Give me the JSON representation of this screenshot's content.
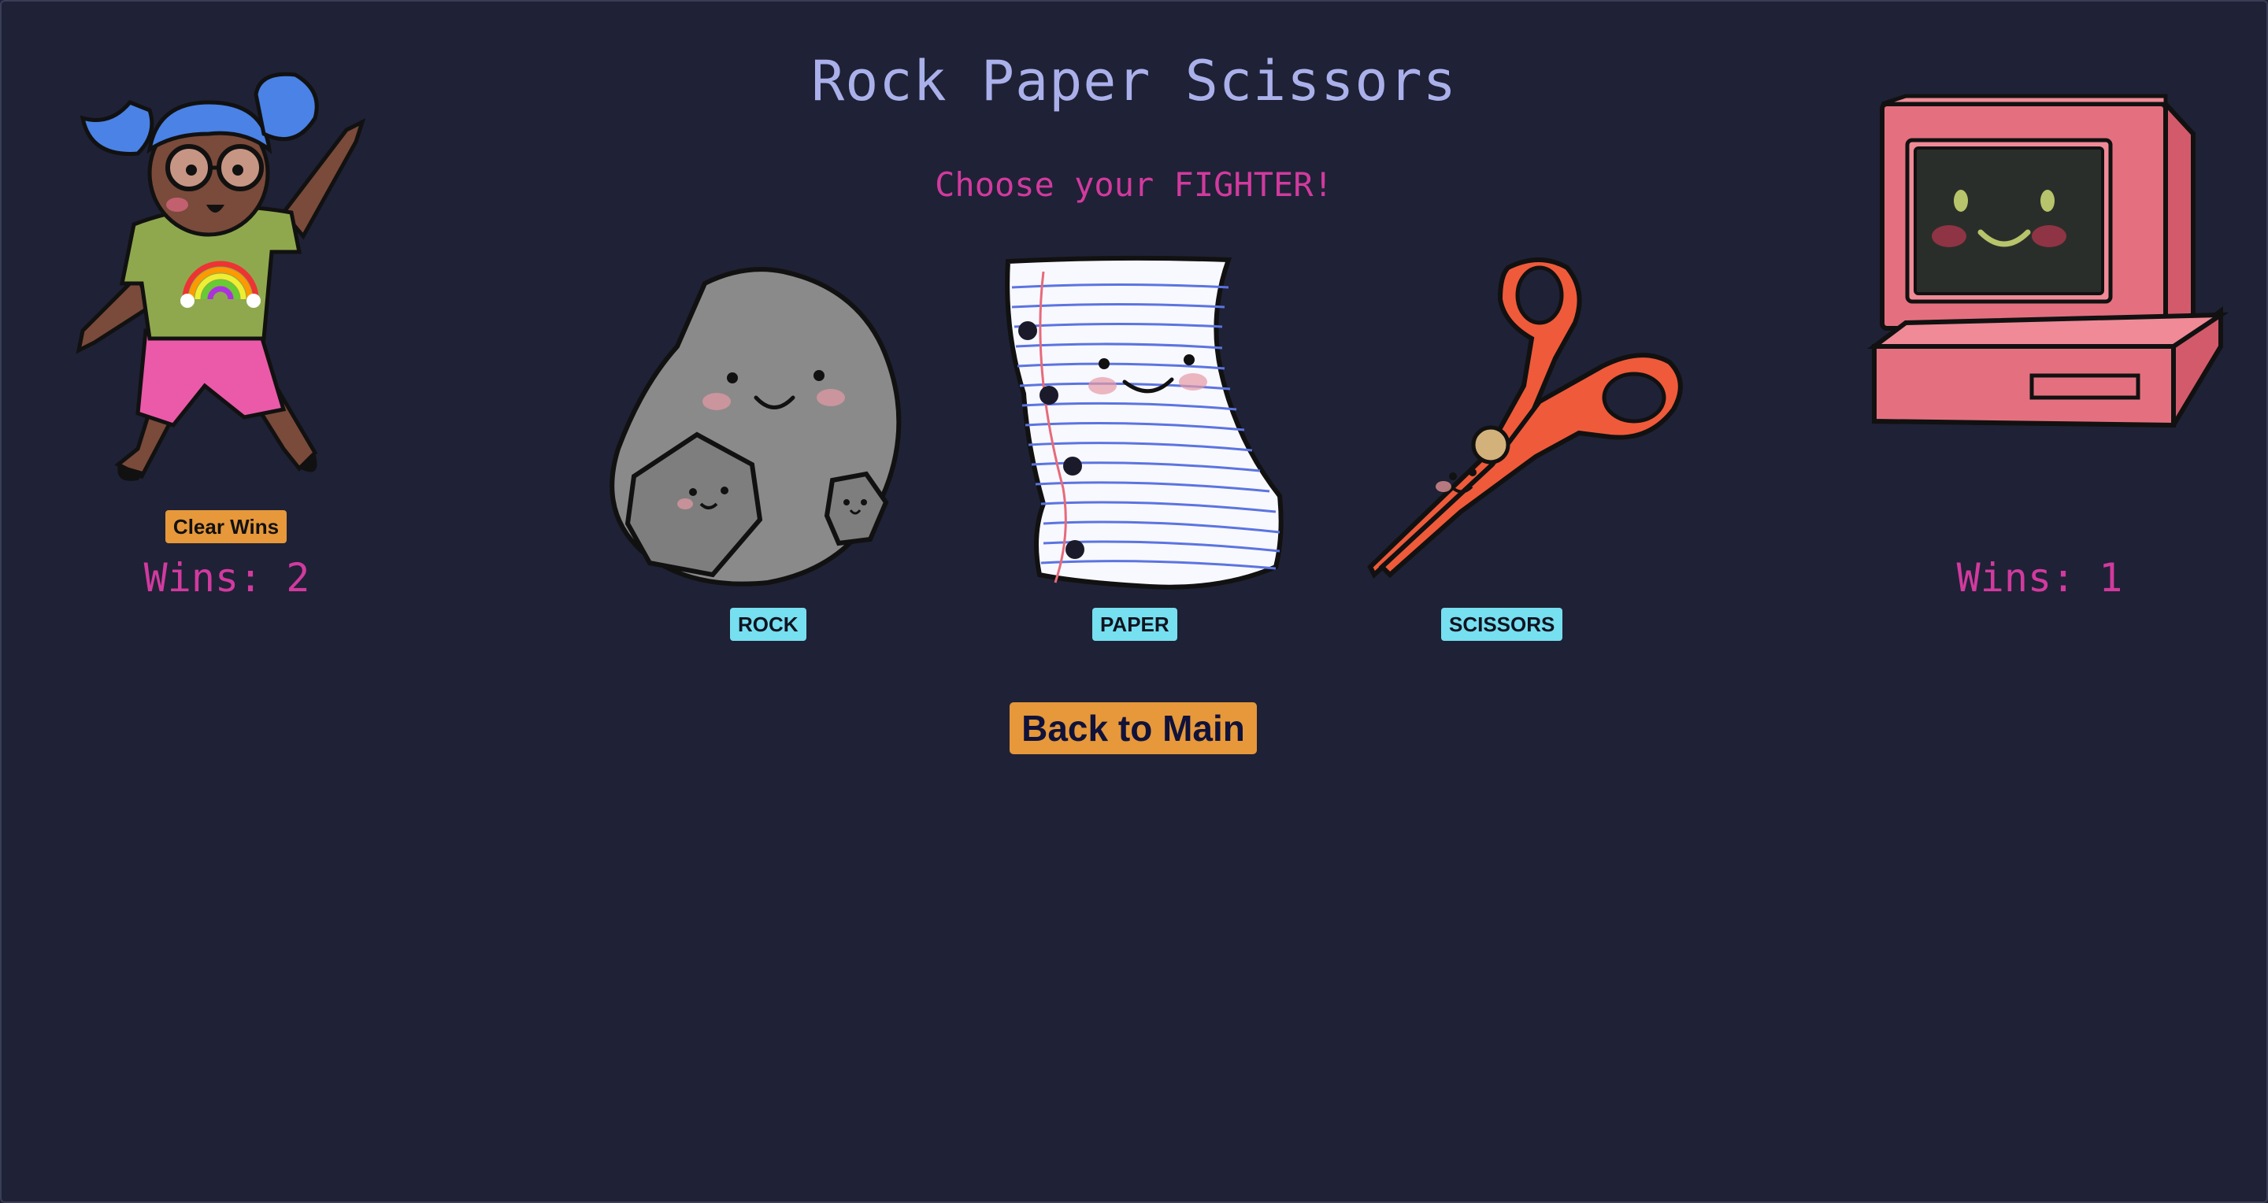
{
  "app": {
    "title": "Rock Paper Scissors",
    "subtitle": "Choose your FIGHTER!"
  },
  "player": {
    "avatar_icon": "girl-character-icon",
    "clear_label": "Clear Wins",
    "wins_text": "Wins: 2"
  },
  "computer": {
    "avatar_icon": "computer-character-icon",
    "wins_text": "Wins: 1"
  },
  "fighters": [
    {
      "id": "rock",
      "label": "ROCK",
      "icon": "rock-icon"
    },
    {
      "id": "paper",
      "label": "PAPER",
      "icon": "paper-icon"
    },
    {
      "id": "scissors",
      "label": "SCISSORS",
      "icon": "scissors-icon"
    }
  ],
  "navigation": {
    "back_label": "Back to Main"
  },
  "colors": {
    "background": "#1f2136",
    "title": "#aab0ea",
    "accent_pink": "#d13a9e",
    "button_orange": "#e6983a",
    "button_cyan": "#76dff0"
  }
}
